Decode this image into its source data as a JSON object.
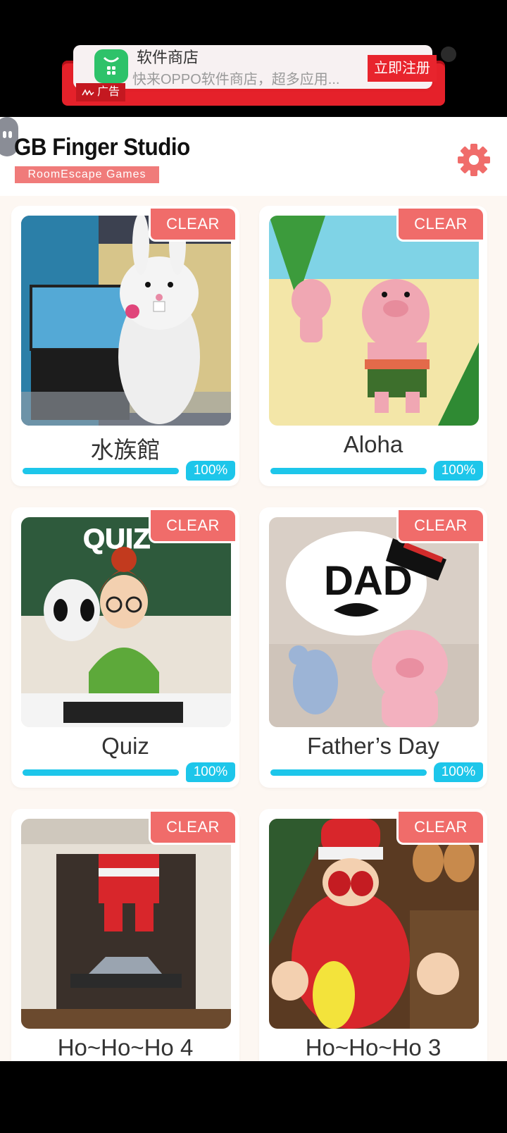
{
  "ad": {
    "app_name": "软件商店",
    "description": "快来OPPO软件商店，超多应用...",
    "cta_label": "立即注册",
    "ad_label": "广告",
    "icon": "shopping-bag-icon"
  },
  "header": {
    "brand": "GB Finger Studio",
    "tagline": "RoomEscape  Games",
    "settings_icon": "gear-icon"
  },
  "colors": {
    "accent": "#f06c6a",
    "progress": "#1dc6ea",
    "background": "#fdf7f2"
  },
  "games": [
    {
      "title": "水族館",
      "badge": "CLEAR",
      "progress_label": "100%",
      "progress": 1.0
    },
    {
      "title": "Aloha",
      "badge": "CLEAR",
      "progress_label": "100%",
      "progress": 1.0
    },
    {
      "title": "Quiz",
      "badge": "CLEAR",
      "progress_label": "100%",
      "progress": 1.0,
      "thumb_text": "QUIZ"
    },
    {
      "title": "Father’s Day",
      "badge": "CLEAR",
      "progress_label": "100%",
      "progress": 1.0,
      "thumb_text": "DAD"
    },
    {
      "title": "Ho~Ho~Ho 4",
      "badge": "CLEAR"
    },
    {
      "title": "Ho~Ho~Ho 3",
      "badge": "CLEAR"
    }
  ]
}
